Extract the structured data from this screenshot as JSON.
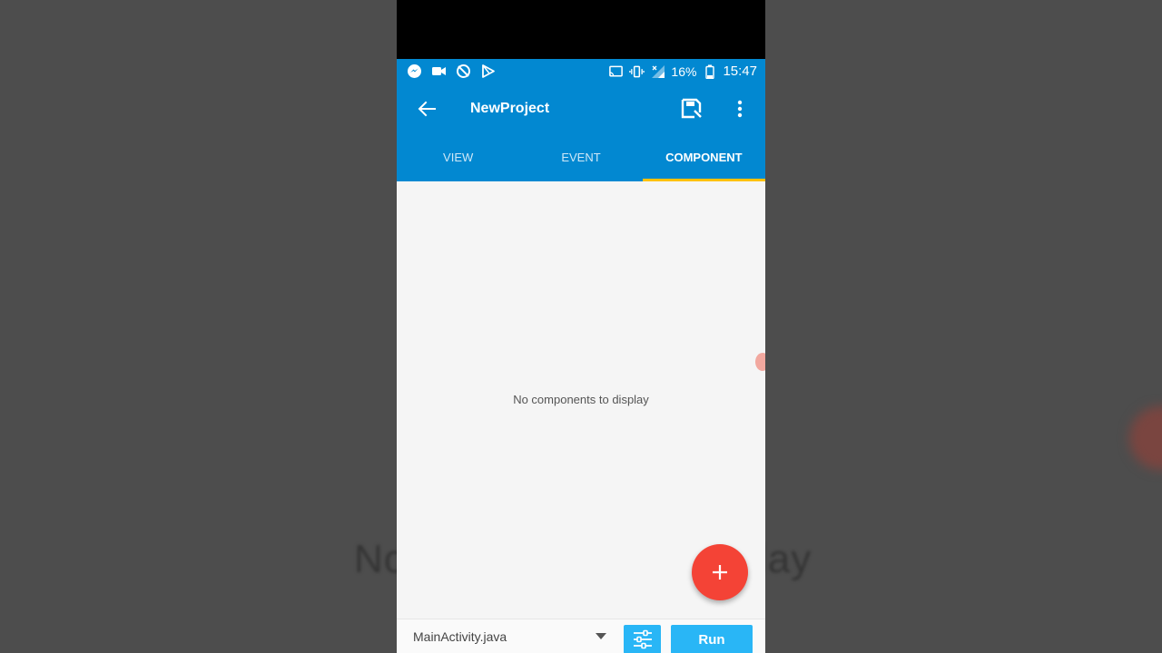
{
  "background": {
    "ghost_left_text": "No",
    "ghost_right_text": "lay"
  },
  "status_bar": {
    "icons_left": [
      "messenger-icon",
      "video-camera-icon",
      "data-saver-icon",
      "play-store-icon"
    ],
    "icons_right": [
      "cast-icon",
      "vibrate-icon",
      "signal-icon"
    ],
    "battery": "16%",
    "time": "15:47"
  },
  "app_bar": {
    "title": "NewProject",
    "color": "#0288d1"
  },
  "tabs": [
    {
      "label": "VIEW",
      "active": false
    },
    {
      "label": "EVENT",
      "active": false
    },
    {
      "label": "COMPONENT",
      "active": true
    }
  ],
  "tab_indicator_color": "#ffc107",
  "content": {
    "empty_message": "No components to display"
  },
  "fab": {
    "icon": "plus-icon",
    "color": "#f44336"
  },
  "bottom_bar": {
    "file_select_value": "MainActivity.java",
    "run_label": "Run",
    "button_color": "#29b6f6"
  }
}
